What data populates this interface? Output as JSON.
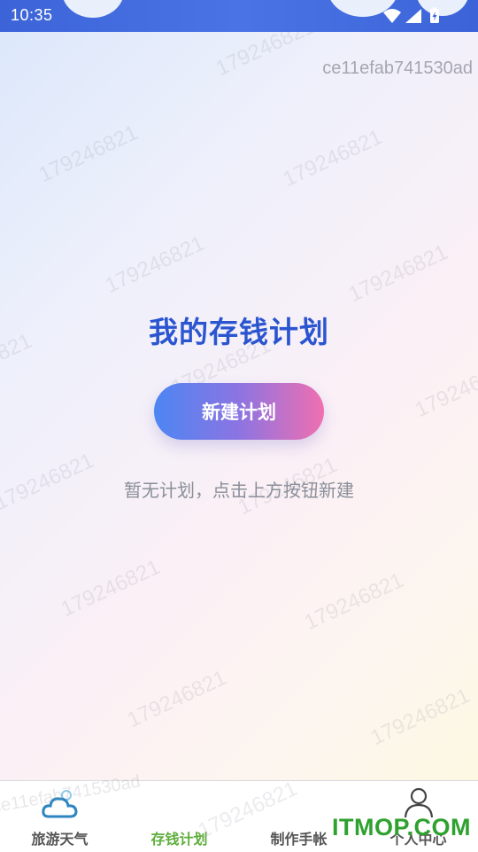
{
  "status_bar": {
    "time": "10:35"
  },
  "device_id": "ce11efab741530ad",
  "watermark_text": "179246821",
  "page": {
    "title": "我的存钱计划",
    "new_plan_button": "新建计划",
    "empty_hint": "暂无计划，点击上方按钮新建"
  },
  "tabs": [
    {
      "label": "旅游天气",
      "icon": "cloud-icon",
      "active": false
    },
    {
      "label": "存钱计划",
      "icon": "",
      "active": true
    },
    {
      "label": "制作手帐",
      "icon": "",
      "active": false
    },
    {
      "label": "个人中心",
      "icon": "person-icon",
      "active": false
    }
  ],
  "brand": "ITMOP.COM",
  "colors": {
    "accent": "#2b55d0",
    "active_tab": "#5fae3c",
    "button_start": "#4c86f3",
    "button_end": "#f06fb0",
    "brand_green": "#2ea12e"
  }
}
